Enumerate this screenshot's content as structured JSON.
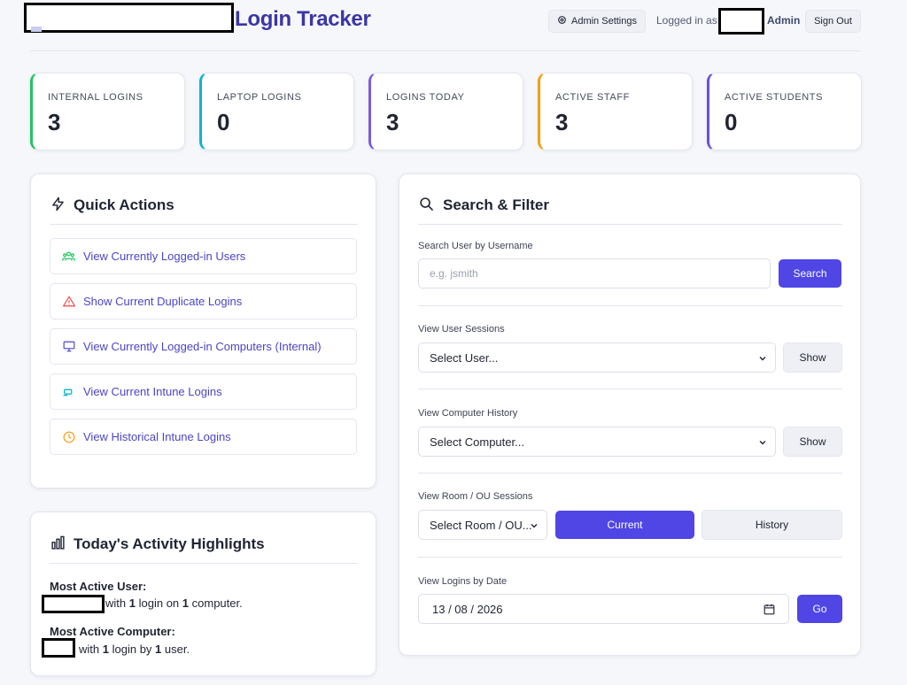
{
  "header": {
    "app_title": "Login Tracker",
    "admin_settings_label": "Admin Settings",
    "logged_in_label": "Logged in as:",
    "user_role": "Admin",
    "sign_out_label": "Sign Out"
  },
  "stats": [
    {
      "label": "INTERNAL LOGINS",
      "value": "3",
      "accent": "#22c55e"
    },
    {
      "label": "LAPTOP LOGINS",
      "value": "0",
      "accent": "#06b6d4"
    },
    {
      "label": "LOGINS TODAY",
      "value": "3",
      "accent": "#7c5cdb"
    },
    {
      "label": "ACTIVE STAFF",
      "value": "3",
      "accent": "#f59e0b"
    },
    {
      "label": "ACTIVE STUDENTS",
      "value": "0",
      "accent": "#6d4fd8"
    }
  ],
  "quick_actions": {
    "title": "Quick Actions",
    "items": [
      {
        "label": "View Currently Logged-in Users",
        "icon": "users-icon"
      },
      {
        "label": "Show Current Duplicate Logins",
        "icon": "warning-icon"
      },
      {
        "label": "View Currently Logged-in Computers (Internal)",
        "icon": "monitor-icon"
      },
      {
        "label": "View Current Intune Logins",
        "icon": "laptop-icon"
      },
      {
        "label": "View Historical Intune Logins",
        "icon": "clock-icon"
      }
    ]
  },
  "highlights": {
    "title": "Today's Activity Highlights",
    "most_active_user_label": "Most Active User:",
    "user_with": "with",
    "user_count": "1",
    "user_mid": "login on",
    "user_count2": "1",
    "user_end": "computer.",
    "most_active_computer_label": "Most Active Computer:",
    "comp_with": "with",
    "comp_count": "1",
    "comp_mid": "login by",
    "comp_count2": "1",
    "comp_end": "user."
  },
  "search": {
    "title": "Search & Filter",
    "username_label": "Search User by Username",
    "username_placeholder": "e.g. jsmith",
    "search_button": "Search",
    "sessions_label": "View User Sessions",
    "sessions_select": "Select User...",
    "show_label": "Show",
    "computer_label": "View Computer History",
    "computer_select": "Select Computer...",
    "room_label": "View Room / OU Sessions",
    "room_select": "Select Room / OU...",
    "current_button": "Current",
    "history_button": "History",
    "date_label": "View Logins by Date",
    "date_value": "13 / 08 / 2026",
    "go_button": "Go"
  },
  "colors": {
    "primary": "#4f46e5",
    "title": "#3b36a6",
    "link": "#4a45c6"
  }
}
